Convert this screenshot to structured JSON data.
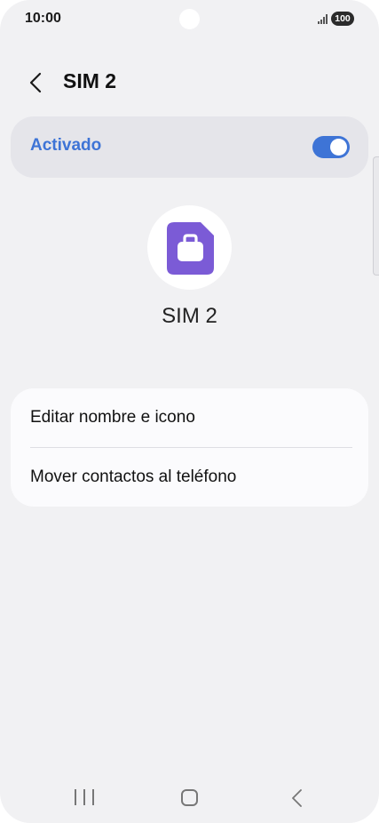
{
  "status_bar": {
    "time": "10:00",
    "battery": "100"
  },
  "header": {
    "title": "SIM 2",
    "back_icon": "chevron-left-icon"
  },
  "activation": {
    "label": "Activado",
    "enabled": true,
    "accent_color": "#3e74d6"
  },
  "sim": {
    "name": "SIM 2",
    "icon": "briefcase-sim-icon",
    "icon_color": "#7b5bd6"
  },
  "options": [
    {
      "label": "Editar nombre e icono"
    },
    {
      "label": "Mover contactos al teléfono"
    }
  ],
  "navigation": {
    "recent": "recent-apps-icon",
    "home": "home-icon",
    "back": "back-icon"
  }
}
